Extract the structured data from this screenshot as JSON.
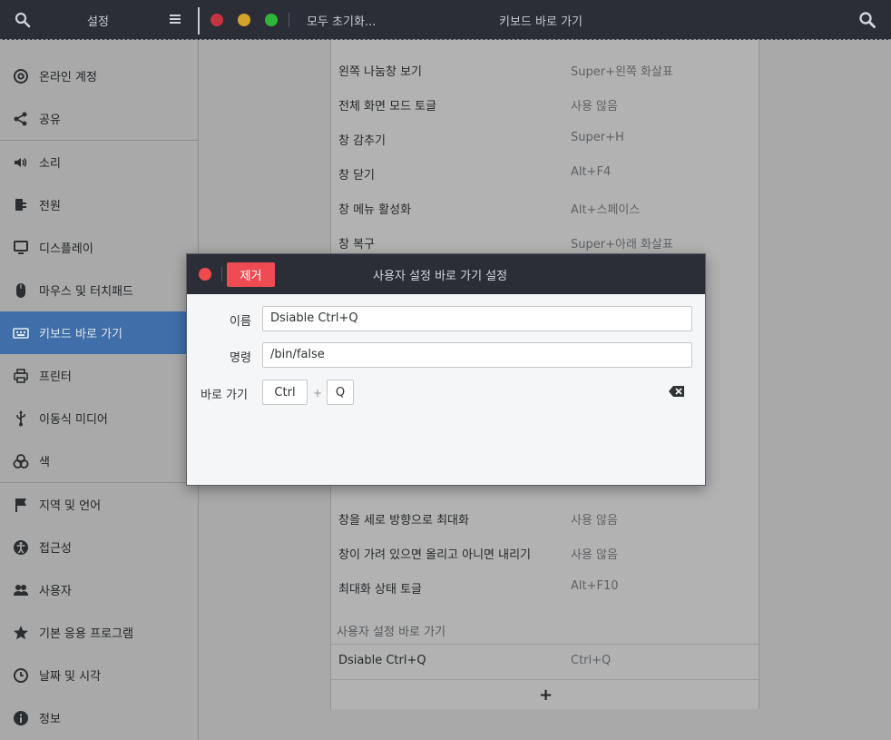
{
  "header": {
    "sidebar_title": "설정",
    "reset_label": "모두 초기화...",
    "page_title": "키보드 바로 가기"
  },
  "sidebar": {
    "items": [
      {
        "label": "온라인 계정",
        "icon": "at-icon"
      },
      {
        "label": "공유",
        "icon": "share-icon"
      },
      {
        "label": "소리",
        "icon": "speaker-icon"
      },
      {
        "label": "전원",
        "icon": "power-plug-icon"
      },
      {
        "label": "디스플레이",
        "icon": "monitor-icon"
      },
      {
        "label": "마우스 및 터치패드",
        "icon": "mouse-icon"
      },
      {
        "label": "키보드 바로 가기",
        "icon": "keyboard-icon",
        "active": true
      },
      {
        "label": "프린터",
        "icon": "printer-icon"
      },
      {
        "label": "이동식 미디어",
        "icon": "usb-icon"
      },
      {
        "label": "색",
        "icon": "color-icon"
      },
      {
        "label": "지역 및 언어",
        "icon": "flag-icon"
      },
      {
        "label": "접근성",
        "icon": "accessibility-icon"
      },
      {
        "label": "사용자",
        "icon": "users-icon"
      },
      {
        "label": "기본 응용 프로그램",
        "icon": "star-icon"
      },
      {
        "label": "날짜 및 시각",
        "icon": "clock-icon"
      },
      {
        "label": "정보",
        "icon": "info-icon"
      }
    ]
  },
  "shortcuts": {
    "rows": [
      {
        "name": "왼쪽 나눔창 보기",
        "accel": "Super+왼쪽 화살표"
      },
      {
        "name": "전체 화면 모드 토글",
        "accel": "사용 않음"
      },
      {
        "name": "창 감추기",
        "accel": "Super+H"
      },
      {
        "name": "창 닫기",
        "accel": "Alt+F4"
      },
      {
        "name": "창 메뉴 활성화",
        "accel": "Alt+스페이스"
      },
      {
        "name": "창 복구",
        "accel": "Super+아래 화살표"
      },
      {
        "name": "창을 세로 방향으로 최대화",
        "accel": "사용 않음"
      },
      {
        "name": "창이 가려 있으면 올리고 아니면 내리기",
        "accel": "사용 않음"
      },
      {
        "name": "최대화 상태 토글",
        "accel": "Alt+F10"
      }
    ],
    "custom_section_title": "사용자 설정 바로 가기",
    "custom_rows": [
      {
        "name": "Dsiable Ctrl+Q",
        "accel": "Ctrl+Q"
      }
    ],
    "add_label": "+"
  },
  "dialog": {
    "title": "사용자 설정 바로 가기 설정",
    "remove_label": "제거",
    "name_label": "이름",
    "name_value": "Dsiable Ctrl+Q",
    "command_label": "명령",
    "command_value": "/bin/false",
    "shortcut_label": "바로 가기",
    "key1": "Ctrl",
    "key_sep": "+",
    "key2": "Q"
  },
  "colors": {
    "accent": "#3f6ea8",
    "destructive": "#ef4b52",
    "headerbar": "#2b2e37"
  }
}
